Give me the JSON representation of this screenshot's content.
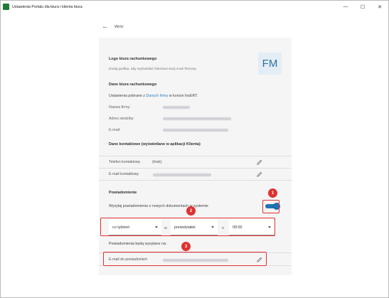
{
  "window": {
    "title": "Ustawienia Portalu dla biura i klienta biura",
    "minimize": "—",
    "maximize": "☐",
    "close": "✕"
  },
  "nav": {
    "back_arrow": "←",
    "back_label": "Wróć"
  },
  "logo": {
    "title": "Logo biura rachunkowego",
    "hint": "Dodaj grafikę, aby wyświetlać klientowi swój znak firmowy.",
    "badge": "FM"
  },
  "company": {
    "title": "Dane biura rachunkowego",
    "info_prefix": "Ustawienia pobrane z ",
    "info_link": "Danych firmy",
    "info_suffix": " w koncie InsERT.",
    "fields": [
      {
        "label": "Nazwa firmy:"
      },
      {
        "label": "Adres siedziby:"
      },
      {
        "label": "E-mail:"
      }
    ]
  },
  "contact": {
    "title": "Dane kontaktowe (wyświetlane w aplikacji Klienta)",
    "rows": [
      {
        "label": "Telefon kontaktowy",
        "value": "(brak)"
      },
      {
        "label": "E-mail kontaktowy",
        "value": ""
      }
    ]
  },
  "notifications": {
    "title": "Powiadomienie",
    "toggle_label": "Wysyłaj powiadomienia o nowych dokumentach w systemie",
    "toggle_on": true,
    "frequency": "co tydzień",
    "sep_w": "w",
    "day": "poniedziałek",
    "sep_o": "o",
    "time": "09:00",
    "sent_to": "Powiadomienia będą wysyłane na:",
    "email_label": "E-mail do powiadomień"
  },
  "annotations": {
    "one": "1",
    "two": "2",
    "three": "3"
  },
  "colors": {
    "accent": "#1f74b8",
    "annotation_red": "#e03131",
    "link": "#2a7dc4"
  }
}
